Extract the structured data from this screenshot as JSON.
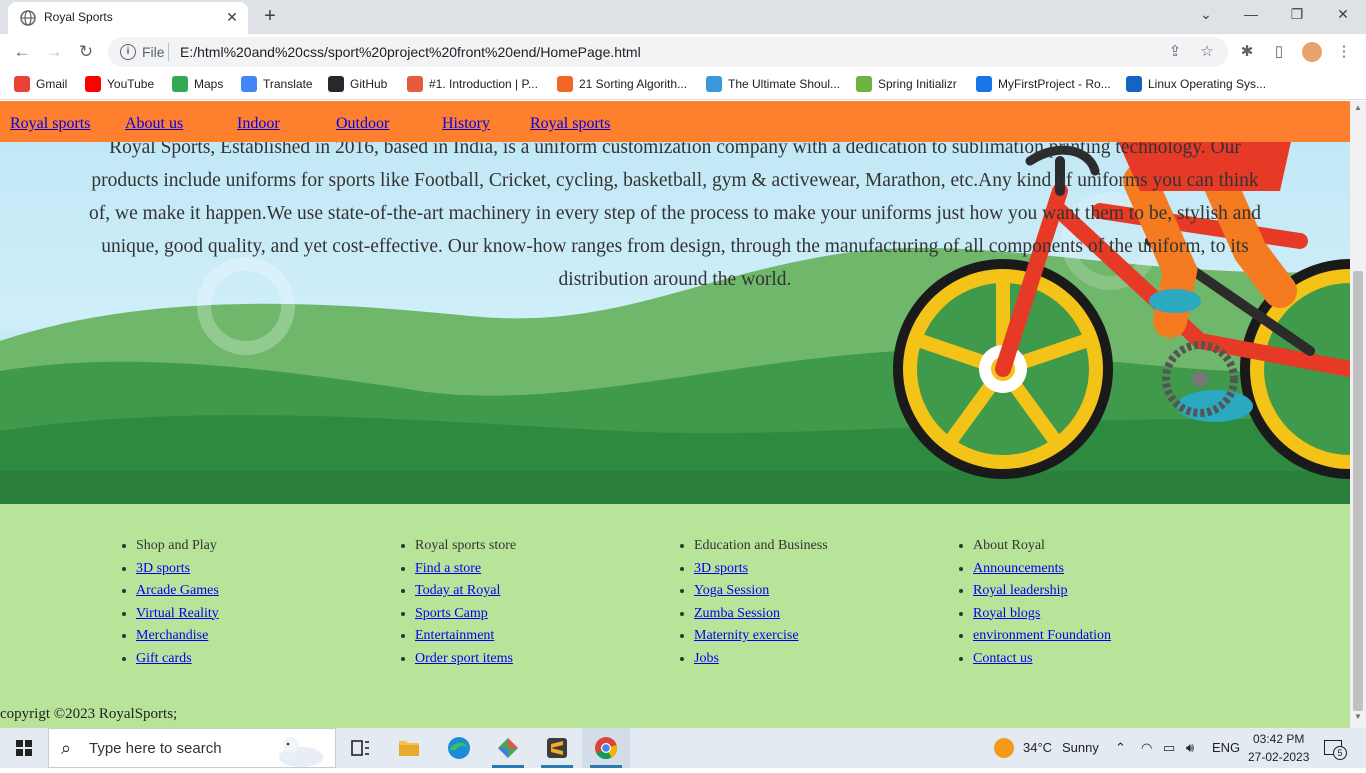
{
  "browser": {
    "tab_title": "Royal Sports",
    "tab_close": "✕",
    "new_tab": "+",
    "window_controls": {
      "tabsearch": "⌄",
      "minimize": "—",
      "restore": "❐",
      "close": "✕"
    },
    "nav": {
      "back": "←",
      "forward": "→",
      "reload": "↻"
    },
    "omnibox": {
      "info_icon": "i",
      "scheme": "File",
      "url": "E:/html%20and%20css/sport%20project%20front%20end/HomePage.html",
      "share_icon": "⇪",
      "star_icon": "☆"
    },
    "toolbar_icons": {
      "extensions": "✱",
      "sidepanel": "▯",
      "menu": "⋮"
    },
    "bookmarks": [
      {
        "label": "Gmail",
        "color": "#ea4335"
      },
      {
        "label": "YouTube",
        "color": "#ff0000"
      },
      {
        "label": "Maps",
        "color": "#34a853"
      },
      {
        "label": "Translate",
        "color": "#4285f4"
      },
      {
        "label": "GitHub",
        "color": "#24292e"
      },
      {
        "label": "#1. Introduction | P...",
        "color": "#e55b3c"
      },
      {
        "label": "21 Sorting Algorith...",
        "color": "#f26522"
      },
      {
        "label": "The Ultimate Shoul...",
        "color": "#3a9ad9"
      },
      {
        "label": "Spring Initializr",
        "color": "#6db33f"
      },
      {
        "label": "MyFirstProject - Ro...",
        "color": "#1a73e8"
      },
      {
        "label": "Linux Operating Sys...",
        "color": "#1565c0"
      }
    ]
  },
  "page": {
    "nav_links": [
      "Royal sports",
      "About us",
      "Indoor",
      "Outdoor",
      "History",
      "Royal sports"
    ],
    "hero_text": "Royal Sports, Established in 2016, based in India, is a uniform customization company with a dedication to sublimation printing technology. Our products include uniforms for sports like Football, Cricket, cycling, basketball, gym & activewear, Marathon, etc.Any kind of uniforms you can think of, we make it happen.We use state-of-the-art machinery in every step of the process to make your uniforms just how you want them to be, stylish and unique, good quality, and yet cost-effective. Our know-how ranges from design, through the manufacturing of all components of the uniform, to its distribution around the world.",
    "footer_columns": [
      {
        "heading": "Shop and Play",
        "links": [
          "3D sports",
          "Arcade Games",
          "Virtual Reality",
          "Merchandise",
          "Gift cards"
        ]
      },
      {
        "heading": "Royal sports store",
        "links": [
          "Find a store",
          "Today at Royal",
          "Sports Camp",
          "Entertainment",
          "Order sport items"
        ]
      },
      {
        "heading": "Education and Business",
        "links": [
          "3D sports",
          "Yoga Session",
          "Zumba Session",
          "Maternity exercise",
          "Jobs"
        ]
      },
      {
        "heading": "About Royal",
        "links": [
          "Announcements",
          "Royal leadership",
          "Royal blogs",
          "environment Foundation",
          "Contact us"
        ]
      }
    ],
    "copyright": "copyrigt ©2023 RoyalSports;",
    "colors": {
      "nav_bg": "#fe7f2d",
      "footer_bg": "#b8e49a",
      "link": "#0000ee"
    }
  },
  "taskbar": {
    "search_placeholder": "Type here to search",
    "search_icon": "⌕",
    "weather_temp": "34°C",
    "weather_desc": "Sunny",
    "tray_chevron": "⌃",
    "language": "ENG",
    "time": "03:42 PM",
    "date": "27-02-2023",
    "notification_count": "5"
  }
}
